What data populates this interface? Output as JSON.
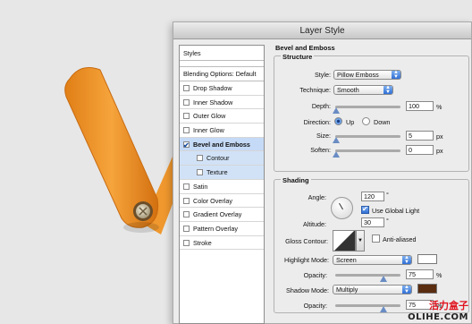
{
  "dialog": {
    "title": "Layer Style"
  },
  "sidebar": {
    "header": "Styles",
    "blending": "Blending Options: Default",
    "items": [
      {
        "label": "Drop Shadow",
        "checked": false
      },
      {
        "label": "Inner Shadow",
        "checked": false
      },
      {
        "label": "Outer Glow",
        "checked": false
      },
      {
        "label": "Inner Glow",
        "checked": false
      },
      {
        "label": "Bevel and Emboss",
        "checked": true
      },
      {
        "label": "Contour",
        "checked": false
      },
      {
        "label": "Texture",
        "checked": false
      },
      {
        "label": "Satin",
        "checked": false
      },
      {
        "label": "Color Overlay",
        "checked": false
      },
      {
        "label": "Gradient Overlay",
        "checked": false
      },
      {
        "label": "Pattern Overlay",
        "checked": false
      },
      {
        "label": "Stroke",
        "checked": false
      }
    ]
  },
  "bevel": {
    "section_title": "Bevel and Emboss",
    "structure_title": "Structure",
    "style_label": "Style:",
    "style_value": "Pillow Emboss",
    "technique_label": "Technique:",
    "technique_value": "Smooth",
    "depth_label": "Depth:",
    "depth_value": "100",
    "depth_unit": "%",
    "direction_label": "Direction:",
    "direction_up": "Up",
    "direction_down": "Down",
    "size_label": "Size:",
    "size_value": "5",
    "size_unit": "px",
    "soften_label": "Soften:",
    "soften_value": "0",
    "soften_unit": "px"
  },
  "shading": {
    "title": "Shading",
    "angle_label": "Angle:",
    "angle_value": "120",
    "angle_unit": "°",
    "global_light_label": "Use Global Light",
    "altitude_label": "Altitude:",
    "altitude_value": "30",
    "altitude_unit": "°",
    "gloss_label": "Gloss Contour:",
    "antialiased_label": "Anti-aliased",
    "highlight_mode_label": "Highlight Mode:",
    "highlight_mode_value": "Screen",
    "highlight_color": "#ffffff",
    "opacity_label": "Opacity:",
    "highlight_opacity": "75",
    "opacity_unit": "%",
    "shadow_mode_label": "Shadow Mode:",
    "shadow_mode_value": "Multiply",
    "shadow_color": "#5a2c10",
    "shadow_opacity": "75"
  },
  "watermark": {
    "line1": "活力盒子",
    "line2": "OLIHE.COM"
  }
}
